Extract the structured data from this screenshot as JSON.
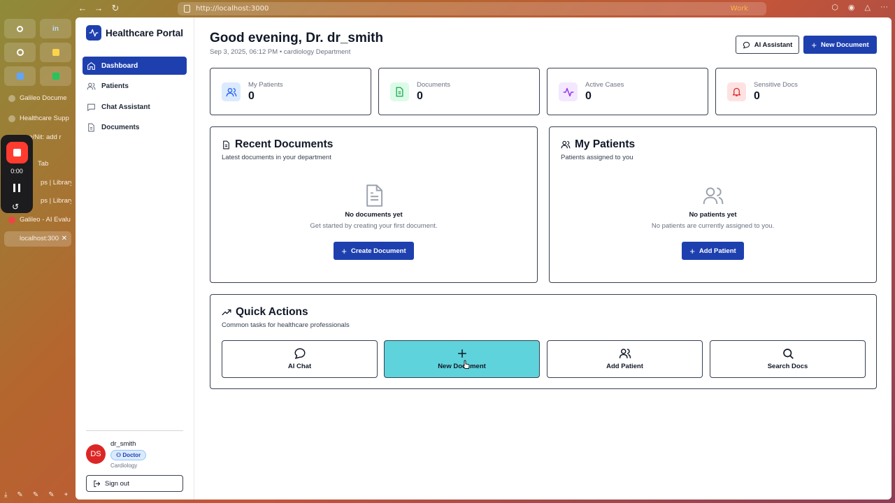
{
  "browser": {
    "url": "http://localhost:3000",
    "profile_badge": "Work",
    "pinned": [
      "",
      "in",
      "",
      "",
      "",
      ""
    ],
    "tabs": [
      {
        "label": "Galileo Docume"
      },
      {
        "label": "Healthcare Supp"
      },
      {
        "label": "re/Nit: add r"
      },
      {
        "label": "Tab"
      },
      {
        "label": "ps | Library"
      },
      {
        "label": "ps | Library"
      },
      {
        "label": "Galileo - AI Evalu"
      },
      {
        "label": "localhost:300",
        "active": true
      }
    ],
    "recorder_time": "0:00"
  },
  "app": {
    "brand": "Healthcare Portal",
    "nav": [
      {
        "label": "Dashboard",
        "icon": "home-icon",
        "active": true
      },
      {
        "label": "Patients",
        "icon": "users-icon"
      },
      {
        "label": "Chat Assistant",
        "icon": "chat-icon"
      },
      {
        "label": "Documents",
        "icon": "document-icon"
      }
    ],
    "user": {
      "initials": "DS",
      "name": "dr_smith",
      "role": "Doctor",
      "department": "Cardiology",
      "signout_label": "Sign out"
    }
  },
  "header": {
    "greeting": "Good evening, Dr. dr_smith",
    "subline": "Sep 3, 2025, 06:12 PM • cardiology Department",
    "ai_button": "AI Assistant",
    "new_doc_button": "New Document"
  },
  "stats": [
    {
      "label": "My Patients",
      "value": "0",
      "icon": "users-icon",
      "color": "#2563eb",
      "bg": "#dbeafe"
    },
    {
      "label": "Documents",
      "value": "0",
      "icon": "document-icon",
      "color": "#16a34a",
      "bg": "#dcfce7"
    },
    {
      "label": "Active Cases",
      "value": "0",
      "icon": "activity-icon",
      "color": "#9333ea",
      "bg": "#f3e8ff"
    },
    {
      "label": "Sensitive Docs",
      "value": "0",
      "icon": "bell-icon",
      "color": "#dc2626",
      "bg": "#fee2e2"
    }
  ],
  "recent_documents": {
    "title": "Recent Documents",
    "subtitle": "Latest documents in your department",
    "empty_title": "No documents yet",
    "empty_desc": "Get started by creating your first document.",
    "button": "Create Document"
  },
  "my_patients": {
    "title": "My Patients",
    "subtitle": "Patients assigned to you",
    "empty_title": "No patients yet",
    "empty_desc": "No patients are currently assigned to you.",
    "button": "Add Patient"
  },
  "quick_actions": {
    "title": "Quick Actions",
    "subtitle": "Common tasks for healthcare professionals",
    "items": [
      {
        "label": "AI Chat",
        "icon": "chat-icon"
      },
      {
        "label": "New Document",
        "icon": "plus-icon",
        "highlighted": true
      },
      {
        "label": "Add Patient",
        "icon": "users-icon"
      },
      {
        "label": "Search Docs",
        "icon": "search-icon"
      }
    ]
  },
  "colors": {
    "primary": "#1e40af",
    "highlight": "#5ed3dc",
    "avatar": "#dc2626"
  }
}
